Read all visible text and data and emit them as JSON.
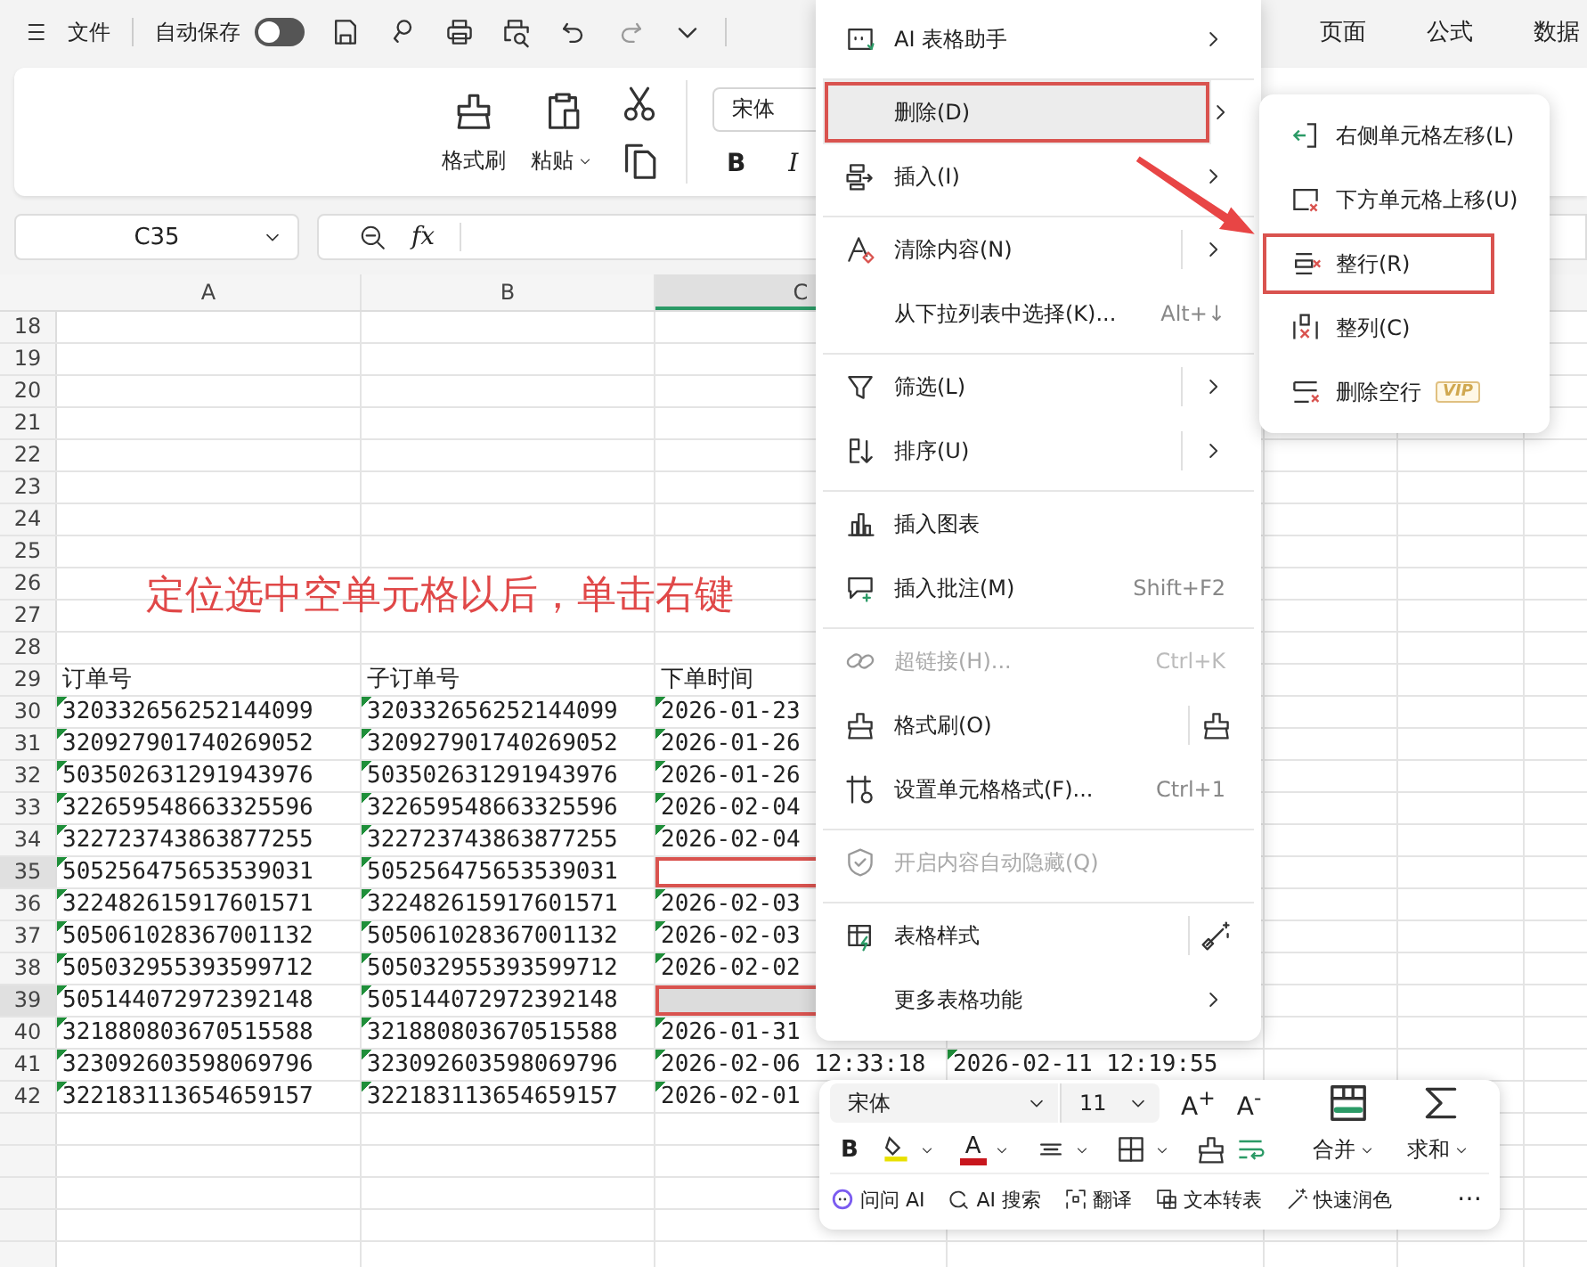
{
  "topbar": {
    "menu_label": "文件",
    "autosave": {
      "label": "自动保存",
      "on": false
    },
    "tabs": [
      {
        "label": "页面",
        "selected": false
      },
      {
        "label": "公式",
        "selected": false
      },
      {
        "label": "数据",
        "selected": false
      }
    ]
  },
  "ribbon": {
    "format_painter": "格式刷",
    "paste": "粘贴",
    "font": "宋体",
    "bold": "B",
    "italic": "I"
  },
  "formula_bar": {
    "cell_ref": "C35",
    "fx": "fx"
  },
  "sheet": {
    "columns": [
      {
        "label": "A",
        "selected": false
      },
      {
        "label": "B",
        "selected": false
      },
      {
        "label": "C",
        "selected": true
      }
    ],
    "rows": [
      {
        "number": "18",
        "selected": false
      },
      {
        "number": "19",
        "selected": false
      },
      {
        "number": "20",
        "selected": false
      },
      {
        "number": "21",
        "selected": false
      },
      {
        "number": "22",
        "selected": false
      },
      {
        "number": "23",
        "selected": false
      },
      {
        "number": "24",
        "selected": false
      },
      {
        "number": "25",
        "selected": false
      },
      {
        "number": "26",
        "selected": false
      },
      {
        "number": "27",
        "selected": false
      },
      {
        "number": "28",
        "selected": false
      },
      {
        "number": "29",
        "selected": false,
        "flagged": false,
        "cells": [
          "订单号",
          "子订单号",
          "下单时间"
        ]
      },
      {
        "number": "30",
        "selected": false,
        "flagged": true,
        "cells": [
          "320332656252144099",
          "320332656252144099",
          "2026-01-23"
        ]
      },
      {
        "number": "31",
        "selected": false,
        "flagged": true,
        "cells": [
          "320927901740269052",
          "320927901740269052",
          "2026-01-26"
        ]
      },
      {
        "number": "32",
        "selected": false,
        "flagged": true,
        "cells": [
          "503502631291943976",
          "503502631291943976",
          "2026-01-26"
        ]
      },
      {
        "number": "33",
        "selected": false,
        "flagged": true,
        "cells": [
          "322659548663325596",
          "322659548663325596",
          "2026-02-04"
        ]
      },
      {
        "number": "34",
        "selected": false,
        "flagged": true,
        "cells": [
          "322723743863877255",
          "322723743863877255",
          "2026-02-04"
        ]
      },
      {
        "number": "35",
        "selected": true,
        "active": true,
        "flagged": true,
        "cells": [
          "505256475653539031",
          "505256475653539031"
        ]
      },
      {
        "number": "36",
        "selected": false,
        "flagged": true,
        "cells": [
          "322482615917601571",
          "322482615917601571",
          "2026-02-03"
        ]
      },
      {
        "number": "37",
        "selected": false,
        "flagged": true,
        "cells": [
          "505061028367001132",
          "505061028367001132",
          "2026-02-03"
        ]
      },
      {
        "number": "38",
        "selected": false,
        "flagged": true,
        "cells": [
          "505032955393599712",
          "505032955393599712",
          "2026-02-02"
        ]
      },
      {
        "number": "39",
        "selected": true,
        "active": false,
        "flagged": true,
        "cells": [
          "505144072972392148",
          "505144072972392148"
        ]
      },
      {
        "number": "40",
        "selected": false,
        "flagged": true,
        "cells": [
          "321880803670515588",
          "321880803670515588",
          "2026-01-31"
        ]
      },
      {
        "number": "41",
        "selected": false,
        "flagged": true,
        "cells": [
          "323092603598069796",
          "323092603598069796",
          "2026-02-06 12:33:18",
          "2026-02-11 12:19:55"
        ]
      },
      {
        "number": "42",
        "selected": false,
        "flagged": true,
        "cells": [
          "322183113654659157",
          "322183113654659157",
          "2026-02-01"
        ]
      }
    ]
  },
  "annotation": "定位选中空单元格以后，单击右键",
  "context_menu": {
    "items": [
      {
        "label": "AI 表格助手",
        "selected": false,
        "disabled": false,
        "submenu": true,
        "split": false,
        "divider_after": true
      },
      {
        "label": "删除(D)",
        "selected": true,
        "disabled": false,
        "submenu": true,
        "split": false,
        "divider_after": false
      },
      {
        "label": "插入(I)",
        "selected": false,
        "disabled": false,
        "submenu": true,
        "split": false,
        "divider_after": true
      },
      {
        "label": "清除内容(N)",
        "selected": false,
        "disabled": false,
        "submenu": true,
        "split": true,
        "divider_after": false
      },
      {
        "label": "从下拉列表中选择(K)...",
        "shortcut": "Alt+↓",
        "selected": false,
        "disabled": false,
        "submenu": false,
        "split": false,
        "divider_after": true
      },
      {
        "label": "筛选(L)",
        "selected": false,
        "disabled": false,
        "submenu": true,
        "split": true,
        "divider_after": false
      },
      {
        "label": "排序(U)",
        "selected": false,
        "disabled": false,
        "submenu": true,
        "split": true,
        "divider_after": true
      },
      {
        "label": "插入图表",
        "selected": false,
        "disabled": false,
        "submenu": false,
        "split": false,
        "divider_after": false
      },
      {
        "label": "插入批注(M)",
        "shortcut": "Shift+F2",
        "selected": false,
        "disabled": false,
        "submenu": false,
        "split": false,
        "divider_after": true
      },
      {
        "label": "超链接(H)...",
        "shortcut": "Ctrl+K",
        "selected": false,
        "disabled": true,
        "submenu": false,
        "split": false,
        "divider_after": false
      },
      {
        "label": "格式刷(O)",
        "selected": false,
        "disabled": false,
        "submenu": false,
        "split": true,
        "divider_after": false
      },
      {
        "label": "设置单元格格式(F)...",
        "shortcut": "Ctrl+1",
        "selected": false,
        "disabled": false,
        "submenu": false,
        "split": false,
        "divider_after": true
      },
      {
        "label": "开启内容自动隐藏(Q)",
        "selected": false,
        "disabled": true,
        "submenu": false,
        "split": false,
        "divider_after": true
      },
      {
        "label": "表格样式",
        "selected": false,
        "disabled": false,
        "submenu": false,
        "split": true,
        "divider_after": false
      },
      {
        "label": "更多表格功能",
        "selected": false,
        "disabled": false,
        "submenu": true,
        "split": false,
        "divider_after": false
      }
    ]
  },
  "submenu": {
    "items": [
      {
        "label": "右侧单元格左移(L)",
        "selected": false
      },
      {
        "label": "下方单元格上移(U)",
        "selected": false
      },
      {
        "label": "整行(R)",
        "selected": true
      },
      {
        "label": "整列(C)",
        "selected": false
      },
      {
        "label": "删除空行",
        "badge": "VIP",
        "selected": false
      }
    ]
  },
  "float_toolbar": {
    "font": "宋体",
    "size": "11",
    "grow": "A$^{+}$",
    "shrink": "A$^{-}$",
    "bold": "B",
    "font_color": "A",
    "merge": "合并",
    "sum": "求和",
    "actions": [
      "问问 AI",
      "AI 搜索",
      "翻译",
      "文本转表",
      "快速润色"
    ],
    "more": "⋯"
  }
}
